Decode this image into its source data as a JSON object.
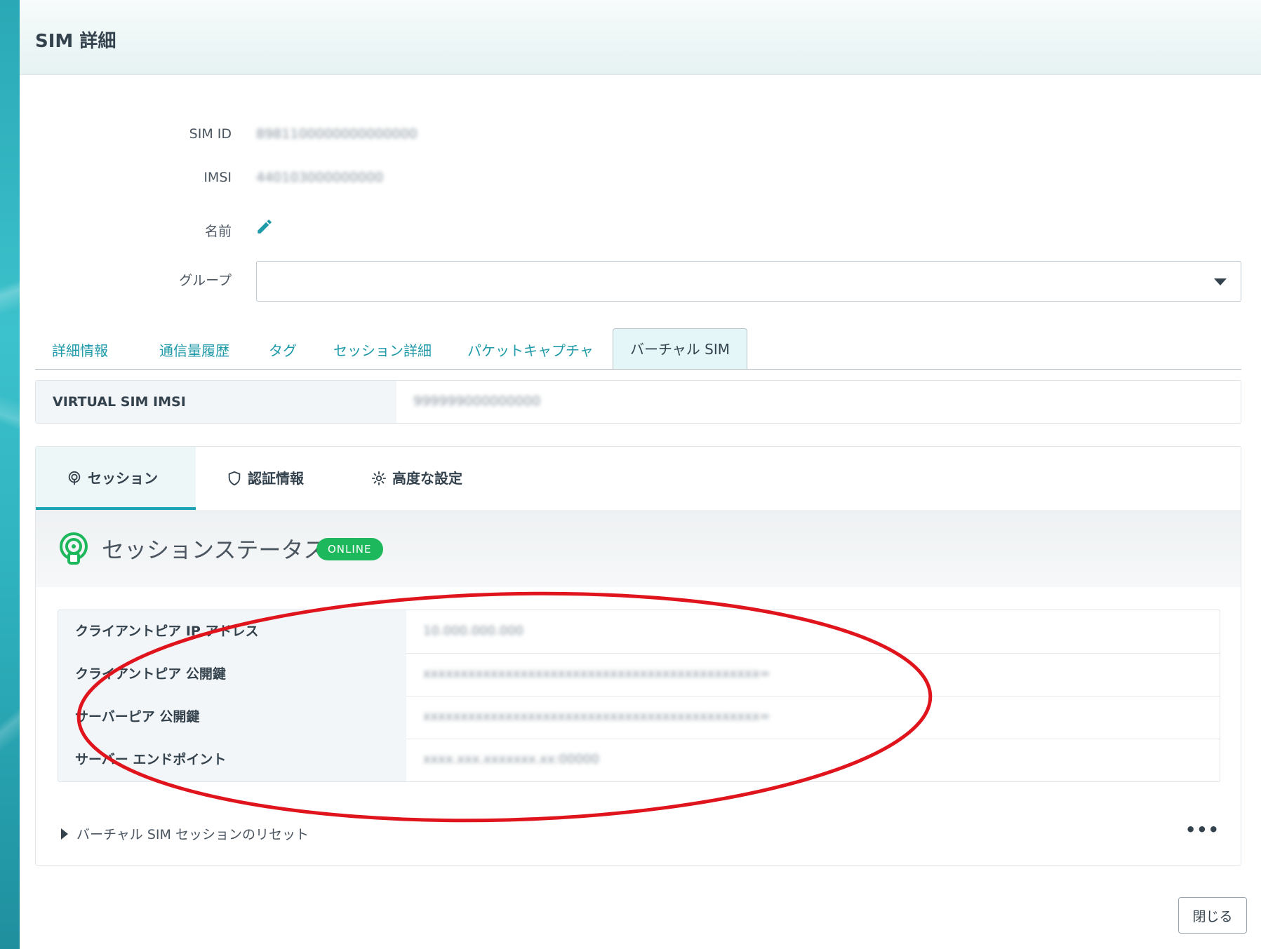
{
  "header": {
    "title": "SIM 詳細"
  },
  "info": {
    "sim_id_label": "SIM ID",
    "sim_id_value": "8981100000000000000",
    "imsi_label": "IMSI",
    "imsi_value": "440103000000000",
    "name_label": "名前",
    "group_label": "グループ"
  },
  "tabs": [
    "詳細情報",
    "通信量履歴",
    "タグ",
    "セッション詳細",
    "パケットキャプチャ",
    "バーチャル SIM"
  ],
  "virtual_sim": {
    "label": "VIRTUAL SIM IMSI",
    "value": "999999000000000"
  },
  "subtabs": [
    "セッション",
    "認証情報",
    "高度な設定"
  ],
  "session": {
    "title": "セッションステータス",
    "badge": "ONLINE",
    "rows": [
      {
        "label": "クライアントピア IP アドレス",
        "value": "10.000.000.000"
      },
      {
        "label": "クライアントピア 公開鍵",
        "value": "xxxxxxxxxxxxxxxxxxxxxxxxxxxxxxxxxxxxxxxxxxxxx="
      },
      {
        "label": "サーバーピア 公開鍵",
        "value": "xxxxxxxxxxxxxxxxxxxxxxxxxxxxxxxxxxxxxxxxxxxxx="
      },
      {
        "label": "サーバー エンドポイント",
        "value": "xxxx.xxx.xxxxxxx.xx:00000"
      }
    ],
    "reset_label": "バーチャル SIM セッションのリセット",
    "more_label": "•••"
  },
  "footer": {
    "close_label": "閉じる"
  },
  "colors": {
    "accent": "#1f9aa8",
    "online": "#1eb85c",
    "annotation": "#e0141c"
  }
}
